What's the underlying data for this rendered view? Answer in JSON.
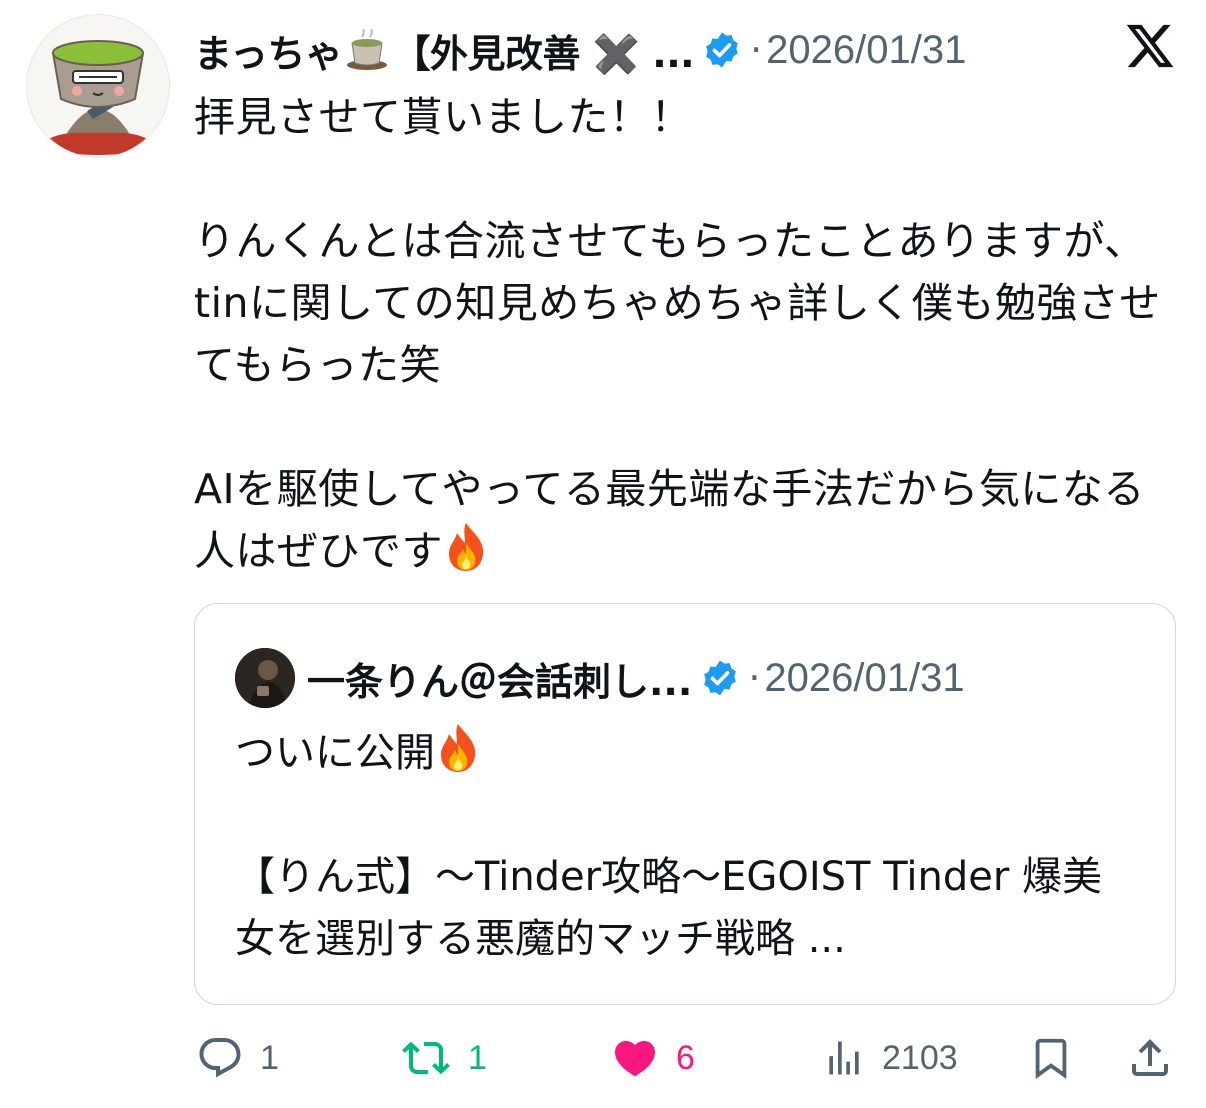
{
  "tweet": {
    "author_name": "まっちゃ",
    "author_name_suffix": "【外見改善 ✖️ ...",
    "separator": "·",
    "date": "2026/01/31",
    "text": "拝見させて貰いました！！\n\nりんくんとは合流させてもらったことありますが、tinに関しての知見めちゃめちゃ詳しく僕も勉強させてもらった笑\n\nAIを駆使してやってる最先端な手法だから気になる人はぜひです",
    "avatar_icon": "matcha-character-avatar",
    "verified_icon": "verified-badge-icon",
    "fire_icon": "fire-emoji-icon"
  },
  "quote": {
    "author_name": "一条りん＠会話刺し...",
    "separator": "·",
    "date": "2026/01/31",
    "line1": "ついに公開",
    "text": "【りん式】〜Tinder攻略〜EGOIST Tinder 爆美女を選別する悪魔的マッチ戦略 ...",
    "avatar_icon": "quote-author-avatar"
  },
  "actions": {
    "replies": "1",
    "retweets": "1",
    "likes": "6",
    "views": "2103"
  },
  "colors": {
    "text": "#0f1419",
    "muted": "#536471",
    "verified": "#1d9bf0",
    "retweet": "#00ba7c",
    "like": "#f91880",
    "border": "#cfd9de"
  }
}
